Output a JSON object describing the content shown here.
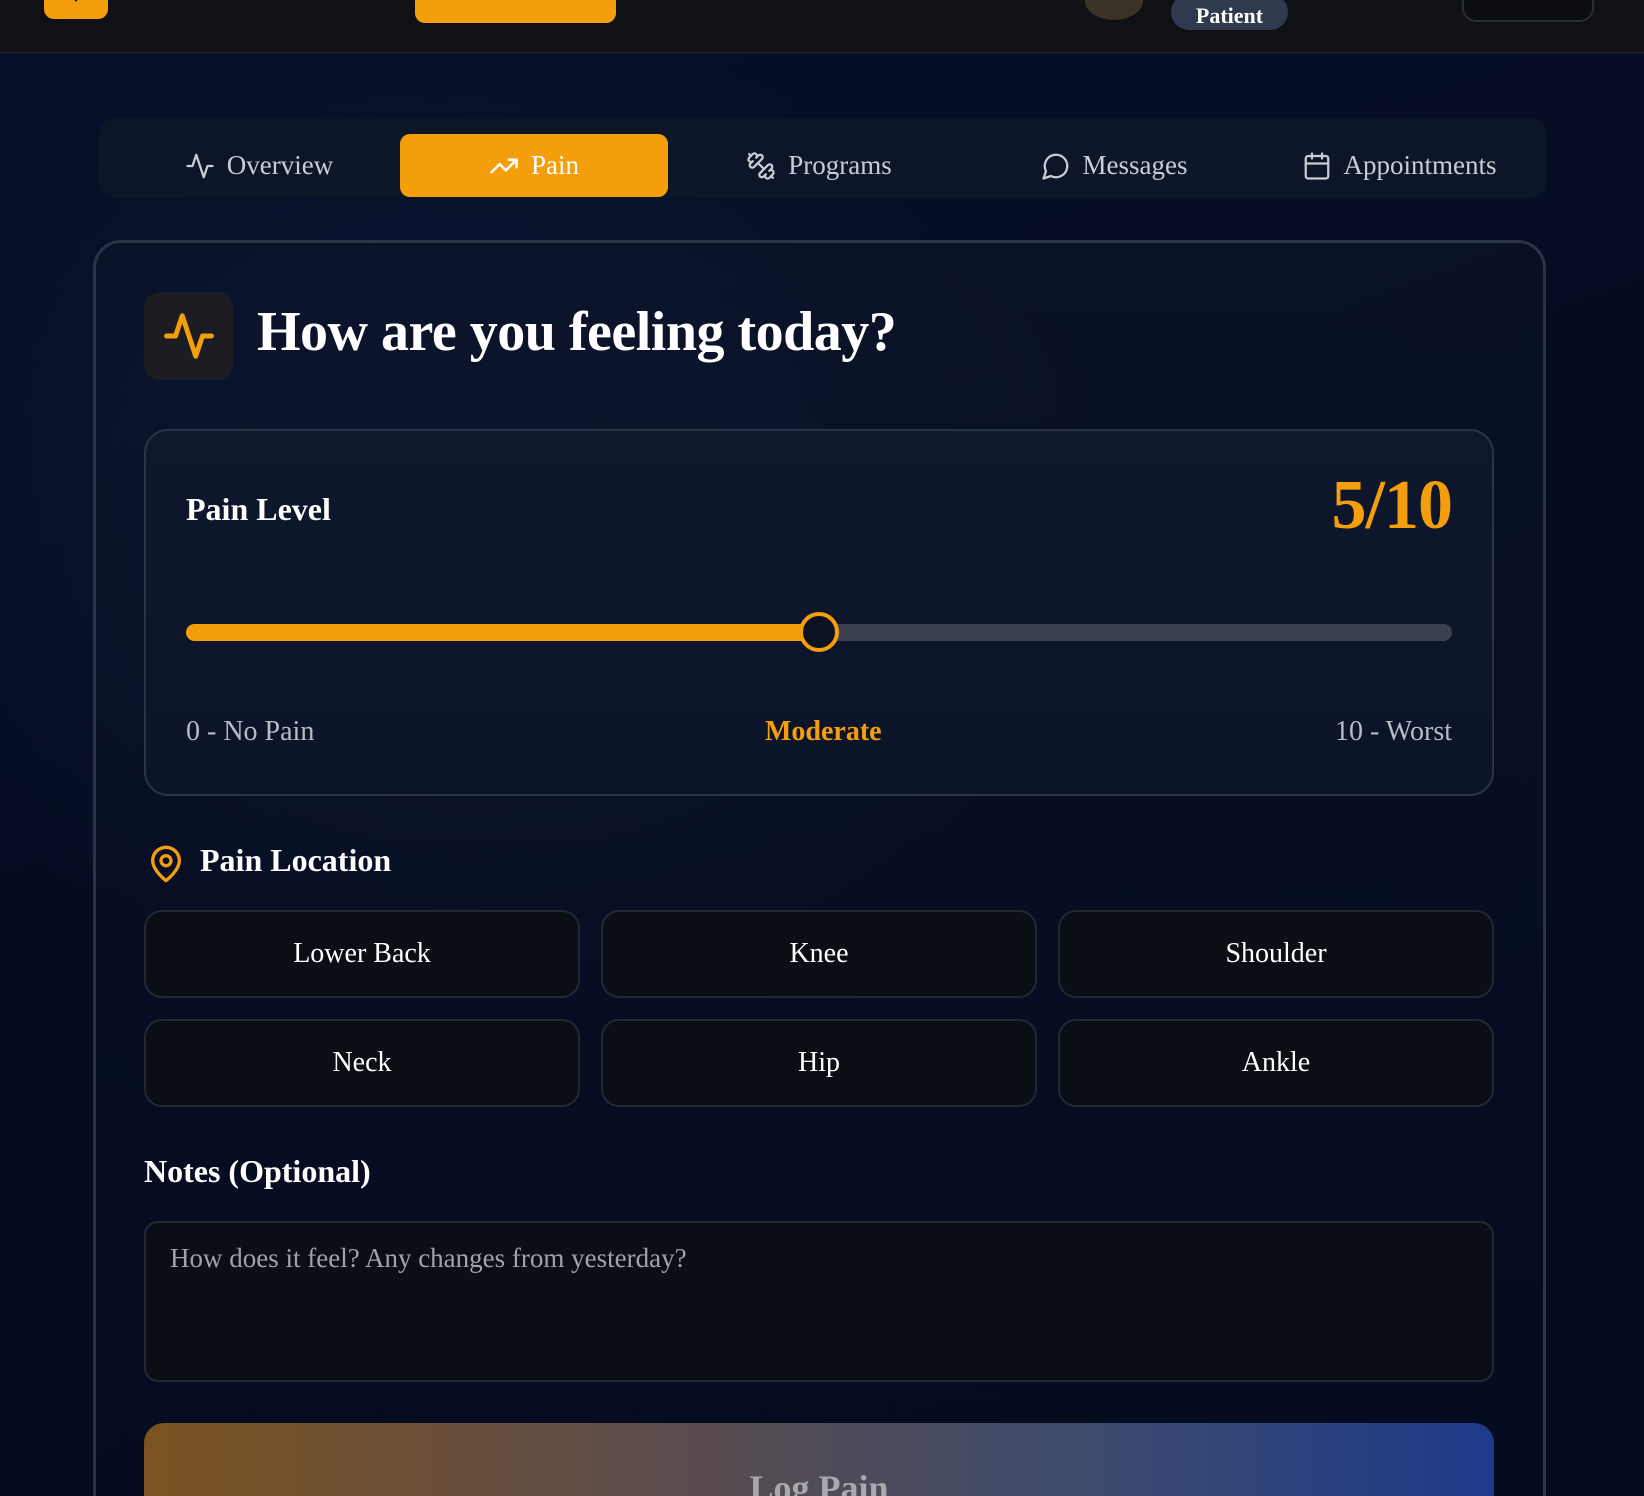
{
  "topbar": {
    "role_badge": "Patient"
  },
  "tabs": [
    {
      "label": "Overview",
      "icon": "activity-icon",
      "active": false
    },
    {
      "label": "Pain",
      "icon": "trending-up-icon",
      "active": true
    },
    {
      "label": "Programs",
      "icon": "dumbbell-icon",
      "active": false
    },
    {
      "label": "Messages",
      "icon": "message-circle-icon",
      "active": false
    },
    {
      "label": "Appointments",
      "icon": "calendar-icon",
      "active": false
    }
  ],
  "form": {
    "title": "How are you feeling today?",
    "pain_level": {
      "label": "Pain Level",
      "value_display": "5/10",
      "value": 5,
      "min": 0,
      "max": 10,
      "min_label": "0 - No Pain",
      "current_label": "Moderate",
      "max_label": "10 - Worst"
    },
    "location": {
      "label": "Pain Location",
      "options": [
        "Lower Back",
        "Knee",
        "Shoulder",
        "Neck",
        "Hip",
        "Ankle"
      ]
    },
    "notes": {
      "label": "Notes (Optional)",
      "placeholder": "How does it feel? Any changes from yesterday?",
      "value": ""
    },
    "submit_label": "Log Pain"
  },
  "colors": {
    "accent": "#f59e0b",
    "background": "#050b1c",
    "panel_border": "#2b3446",
    "track": "#394150"
  }
}
